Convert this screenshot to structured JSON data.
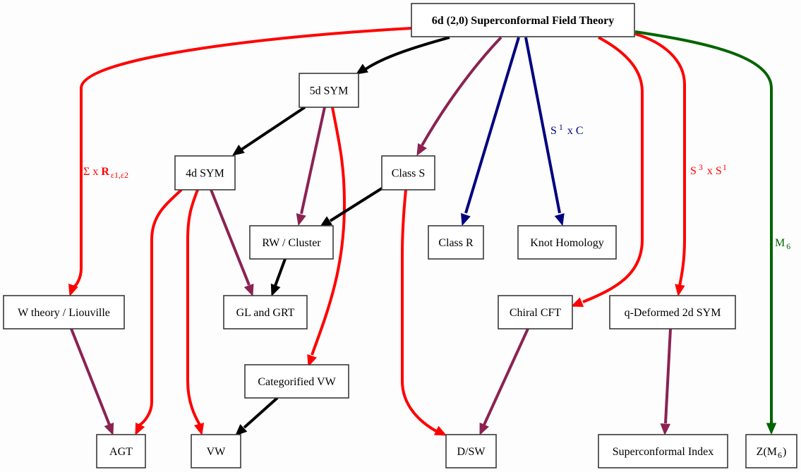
{
  "diagram": {
    "colors": {
      "red": "#ff0000",
      "black": "#000000",
      "purple": "#8b2252",
      "navy": "#000080",
      "green": "#006400"
    },
    "nodes": [
      {
        "id": "6d",
        "label": "6d (2,0) Superconformal Field Theory",
        "bold": true
      },
      {
        "id": "5d",
        "label": "5d SYM"
      },
      {
        "id": "4d",
        "label": "4d SYM"
      },
      {
        "id": "classS",
        "label": "Class S"
      },
      {
        "id": "rw",
        "label": "RW / Cluster"
      },
      {
        "id": "classR",
        "label": "Class R"
      },
      {
        "id": "knot",
        "label": "Knot Homology"
      },
      {
        "id": "wtheory",
        "label": "W theory / Liouville"
      },
      {
        "id": "glgrt",
        "label": "GL and GRT"
      },
      {
        "id": "chiral",
        "label": "Chiral CFT"
      },
      {
        "id": "qdef",
        "label": "q-Deformed 2d SYM"
      },
      {
        "id": "catvw",
        "label": "Categorified VW"
      },
      {
        "id": "agt",
        "label": "AGT"
      },
      {
        "id": "vw",
        "label": "VW"
      },
      {
        "id": "dsw",
        "label": "D/SW"
      },
      {
        "id": "sci",
        "label": "Superconformal Index"
      },
      {
        "id": "zm6",
        "label": "Z(M",
        "label_sub": "6",
        "label_end": ")"
      }
    ],
    "edges": [
      {
        "from": "6d",
        "to": "wtheory",
        "color": "red",
        "label": {
          "main": "Σ x ",
          "bold": "R",
          "sub": "ε1,ε2"
        }
      },
      {
        "from": "6d",
        "to": "5d",
        "color": "black"
      },
      {
        "from": "6d",
        "to": "classS",
        "color": "purple"
      },
      {
        "from": "6d",
        "to": "classR",
        "color": "navy"
      },
      {
        "from": "6d",
        "to": "knot",
        "color": "navy",
        "label": {
          "main": "S",
          "sup": "1",
          "rest": " x C"
        }
      },
      {
        "from": "6d",
        "to": "chiral",
        "color": "red"
      },
      {
        "from": "6d",
        "to": "qdef",
        "color": "red",
        "label": {
          "main": "S",
          "sup": "3",
          "rest": " x S",
          "sup2": "1"
        }
      },
      {
        "from": "6d",
        "to": "zm6",
        "color": "green",
        "label": {
          "main": "M",
          "sub": "6"
        }
      },
      {
        "from": "5d",
        "to": "4d",
        "color": "black"
      },
      {
        "from": "5d",
        "to": "rw",
        "color": "purple"
      },
      {
        "from": "5d",
        "to": "catvw",
        "color": "red"
      },
      {
        "from": "4d",
        "to": "agt",
        "color": "red"
      },
      {
        "from": "4d",
        "to": "vw",
        "color": "red"
      },
      {
        "from": "4d",
        "to": "glgrt",
        "color": "purple"
      },
      {
        "from": "classS",
        "to": "rw",
        "color": "black"
      },
      {
        "from": "classS",
        "to": "dsw",
        "color": "red"
      },
      {
        "from": "rw",
        "to": "glgrt",
        "color": "black"
      },
      {
        "from": "wtheory",
        "to": "agt",
        "color": "purple"
      },
      {
        "from": "catvw",
        "to": "vw",
        "color": "black"
      },
      {
        "from": "chiral",
        "to": "dsw",
        "color": "purple"
      },
      {
        "from": "qdef",
        "to": "sci",
        "color": "purple"
      }
    ]
  }
}
